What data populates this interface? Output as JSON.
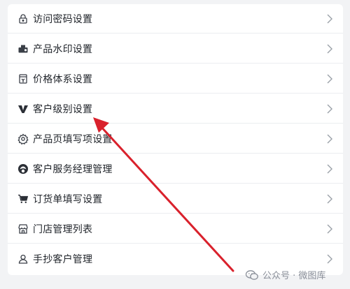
{
  "menu": {
    "items": [
      {
        "label": "访问密码设置",
        "icon": "lock-icon"
      },
      {
        "label": "产品水印设置",
        "icon": "watermark-stamp-icon"
      },
      {
        "label": "价格体系设置",
        "icon": "price-tag-icon"
      },
      {
        "label": "客户级别设置",
        "icon": "vip-level-icon"
      },
      {
        "label": "产品页填写项设置",
        "icon": "gear-icon"
      },
      {
        "label": "客户服务经理管理",
        "icon": "service-manager-icon"
      },
      {
        "label": "订货单填写设置",
        "icon": "cart-icon"
      },
      {
        "label": "门店管理列表",
        "icon": "store-icon"
      },
      {
        "label": "手抄客户管理",
        "icon": "user-icon"
      }
    ]
  },
  "watermark": {
    "text": "公众号 · 微图库",
    "icon": "wechat-icon"
  },
  "colors": {
    "annotation_arrow": "#d9212c",
    "text": "#1f2329",
    "chevron": "#9aa0a8"
  }
}
